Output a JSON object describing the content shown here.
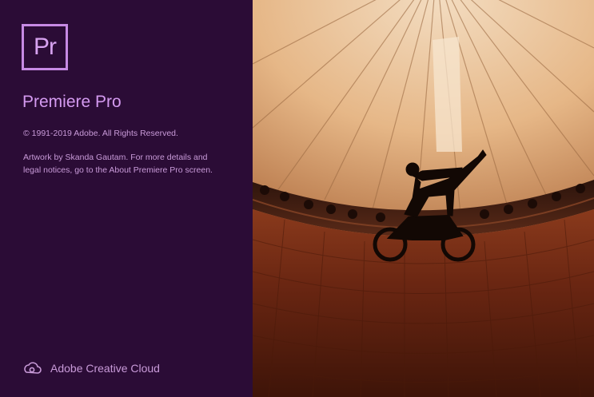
{
  "logo": {
    "text": "Pr"
  },
  "product": {
    "name": "Premiere Pro"
  },
  "copyright": "© 1991-2019 Adobe. All Rights Reserved.",
  "credits": "Artwork by Skanda Gautam. For more details and legal notices, go to the About Premiere Pro screen.",
  "brand": {
    "label": "Adobe Creative Cloud",
    "icon": "creative-cloud-icon"
  },
  "colors": {
    "panel_bg": "#2b0c36",
    "accent": "#c78ae4",
    "text": "#c89ad8"
  },
  "artwork": {
    "description_icon": "motorcycle-well-of-death-artwork"
  }
}
